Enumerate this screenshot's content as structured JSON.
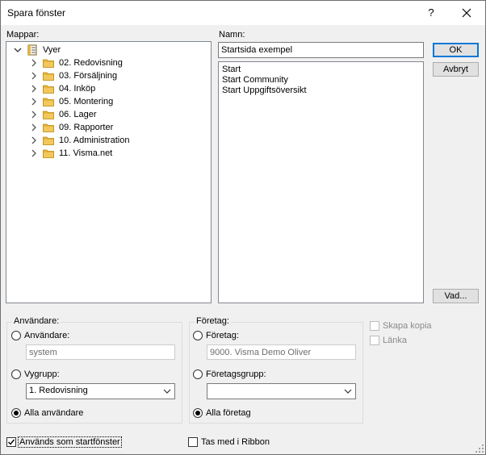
{
  "window": {
    "title": "Spara fönster",
    "help": "?",
    "close": "close"
  },
  "folders": {
    "label": "Mappar:",
    "root": "Vyer",
    "items": [
      {
        "label": "02. Redovisning"
      },
      {
        "label": "03. Försäljning"
      },
      {
        "label": "04. Inköp"
      },
      {
        "label": "05. Montering"
      },
      {
        "label": "06. Lager"
      },
      {
        "label": "09. Rapporter"
      },
      {
        "label": "10. Administration"
      },
      {
        "label": "11. Visma.net"
      }
    ]
  },
  "name": {
    "label": "Namn:",
    "value": "Startsida exempel",
    "list": [
      "Start",
      "Start Community",
      "Start Uppgiftsöversikt"
    ]
  },
  "buttons": {
    "ok": "OK",
    "cancel": "Avbryt",
    "what": "Vad..."
  },
  "users": {
    "group_title": "Användare:",
    "user_label": "Användare:",
    "user_value": "system",
    "viewgroup_label": "Vygrupp:",
    "viewgroup_value": "1. Redovisning",
    "all_label": "Alla användare",
    "selected": "all"
  },
  "company": {
    "group_title": "Företag:",
    "company_label": "Företag:",
    "company_value": "9000. Visma Demo Oliver",
    "companygroup_label": "Företagsgrupp:",
    "companygroup_value": "",
    "all_label": "Alla företag",
    "selected": "all"
  },
  "options": {
    "copy_label": "Skapa kopia",
    "copy_checked": false,
    "link_label": "Länka",
    "link_checked": false,
    "startwindow_label": "Används som startfönster",
    "startwindow_checked": true,
    "ribbon_label": "Tas med i Ribbon",
    "ribbon_checked": false
  },
  "colors": {
    "folder": "#e6b53c",
    "focus": "#0078d7"
  }
}
